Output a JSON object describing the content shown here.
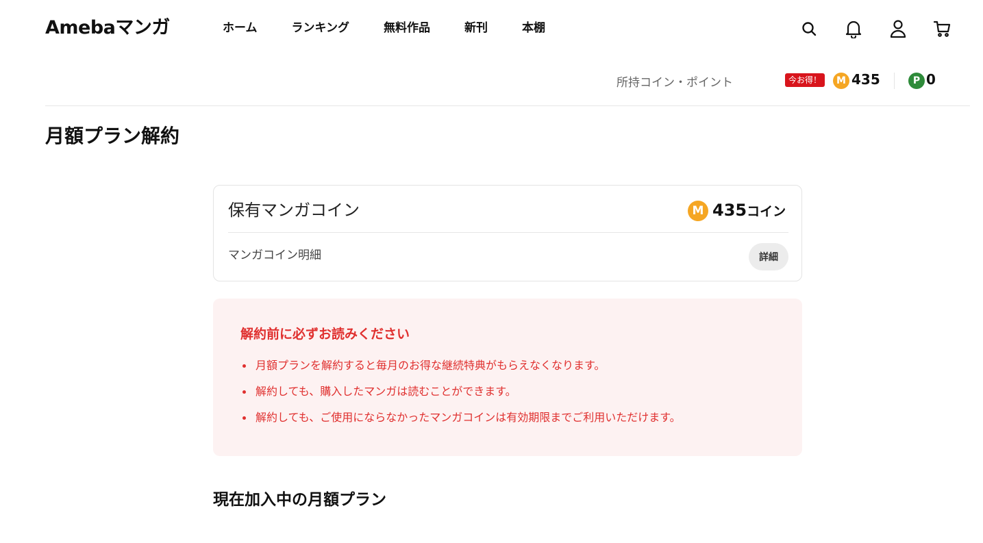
{
  "header": {
    "logo": "Amebaマンガ",
    "nav": [
      "ホーム",
      "ランキング",
      "無料作品",
      "新刊",
      "本棚"
    ],
    "icons": [
      "search-icon",
      "bell-icon",
      "user-icon",
      "cart-icon"
    ]
  },
  "coinbar": {
    "label": "所持コイン・ポイント",
    "deal_badge": "今お得！",
    "coin_symbol": "M",
    "coin_amount": "435",
    "point_symbol": "P",
    "point_amount": "0"
  },
  "page": {
    "title": "月額プラン解約"
  },
  "coin_card": {
    "title": "保有マンガコイン",
    "coin_symbol": "M",
    "amount": "435",
    "unit": "コイン",
    "sub_label": "マンガコイン明細",
    "detail_button": "詳細"
  },
  "notice": {
    "title": "解約前に必ずお読みください",
    "items": [
      "月額プランを解約すると毎月のお得な継続特典がもらえなくなります。",
      "解約しても、購入したマンガは読むことができます。",
      "解約しても、ご使用にならなかったマンガコインは有効期限までご利用いただけます。"
    ]
  },
  "current_plan": {
    "title": "現在加入中の月額プラン"
  },
  "colors": {
    "accent_red": "#e0302f",
    "notice_bg": "#fdf2f2",
    "coin_gold": "#f5a623",
    "point_green": "#2e8b3a",
    "badge_red": "#d8141c"
  }
}
